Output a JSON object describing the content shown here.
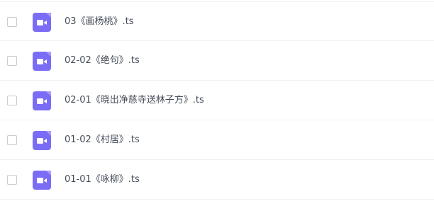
{
  "colors": {
    "icon_bg": "#7b6cf6",
    "icon_fg": "#ffffff",
    "text": "#454d5a",
    "divider": "#eef0f4",
    "checkbox_border": "#c8ccd3"
  },
  "files": [
    {
      "name": "03《画杨桃》.ts",
      "icon": "video-file-icon",
      "checked": false
    },
    {
      "name": "02-02《绝句》.ts",
      "icon": "video-file-icon",
      "checked": false
    },
    {
      "name": "02-01《晓出净慈寺送林子方》.ts",
      "icon": "video-file-icon",
      "checked": false
    },
    {
      "name": "01-02《村居》.ts",
      "icon": "video-file-icon",
      "checked": false
    },
    {
      "name": "01-01《咏柳》.ts",
      "icon": "video-file-icon",
      "checked": false
    }
  ]
}
